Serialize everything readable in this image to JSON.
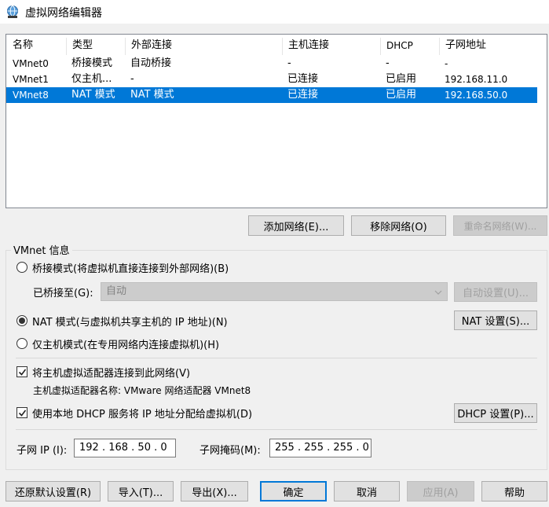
{
  "window": {
    "title": "虚拟网络编辑器"
  },
  "table": {
    "headers": [
      "名称",
      "类型",
      "外部连接",
      "主机连接",
      "DHCP",
      "子网地址"
    ],
    "rows": [
      {
        "name": "VMnet0",
        "type": "桥接模式",
        "external": "自动桥接",
        "host": "-",
        "dhcp": "-",
        "subnet": "-"
      },
      {
        "name": "VMnet1",
        "type": "仅主机...",
        "external": "-",
        "host": "已连接",
        "dhcp": "已启用",
        "subnet": "192.168.11.0"
      },
      {
        "name": "VMnet8",
        "type": "NAT 模式",
        "external": "NAT 模式",
        "host": "已连接",
        "dhcp": "已启用",
        "subnet": "192.168.50.0",
        "selected": true
      }
    ]
  },
  "network_buttons": {
    "add": "添加网络(E)...",
    "remove": "移除网络(O)",
    "rename": "重命名网络(W)..."
  },
  "vmnet_info": {
    "group_label": "VMnet 信息",
    "bridged_radio": "桥接模式(将虚拟机直接连接到外部网络)(B)",
    "bridged_to_label": "已桥接至(G):",
    "bridged_to_value": "自动",
    "auto_settings": "自动设置(U)...",
    "nat_radio": "NAT 模式(与虚拟机共享主机的 IP 地址)(N)",
    "nat_settings": "NAT 设置(S)...",
    "hostonly_radio": "仅主机模式(在专用网络内连接虚拟机)(H)",
    "selected_mode": "nat",
    "connect_adapter_check": "将主机虚拟适配器连接到此网络(V)",
    "connect_adapter_checked": true,
    "adapter_name_text": "主机虚拟适配器名称: VMware 网络适配器 VMnet8",
    "dhcp_check": "使用本地 DHCP 服务将 IP 地址分配给虚拟机(D)",
    "dhcp_checked": true,
    "dhcp_settings": "DHCP 设置(P)...",
    "subnet_ip_label": "子网 IP (I):",
    "subnet_ip_value": "192 . 168 . 50 . 0",
    "subnet_mask_label": "子网掩码(M):",
    "subnet_mask_value": "255 . 255 . 255 . 0"
  },
  "footer": {
    "restore": "还原默认设置(R)",
    "import": "导入(T)...",
    "export": "导出(X)...",
    "ok": "确定",
    "cancel": "取消",
    "apply": "应用(A)",
    "help": "帮助"
  },
  "colors": {
    "selection": "#0078d7",
    "window_bg": "#f0f0f0"
  }
}
